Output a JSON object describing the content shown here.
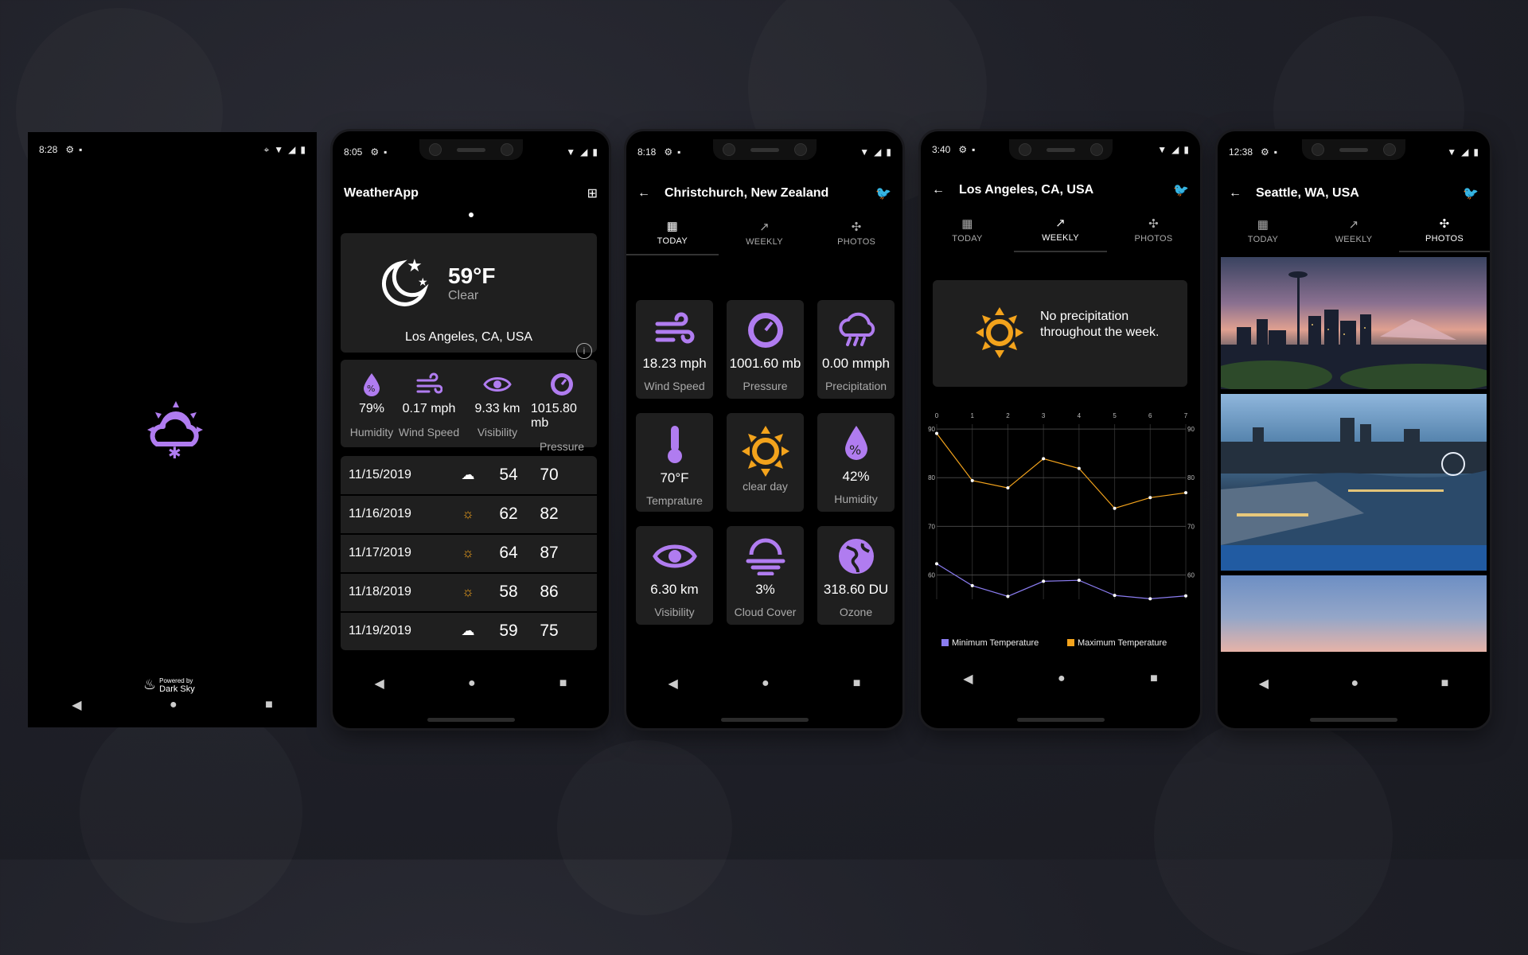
{
  "accent": "#b07cf0",
  "sun_color": "#f3a31c",
  "splash": {
    "time": "8:28",
    "powered_by": "Powered by",
    "dark_sky": "Dark Sky",
    "nav": [
      "◀",
      "●",
      "■"
    ]
  },
  "home": {
    "time": "8:05",
    "app_title": "WeatherApp",
    "current": {
      "temp": "59°F",
      "condition": "Clear",
      "location": "Los Angeles, CA, USA"
    },
    "stats": [
      {
        "value": "79%",
        "label": "Humidity"
      },
      {
        "value": "0.17 mph",
        "label": "Wind Speed"
      },
      {
        "value": "9.33 km",
        "label": "Visibility"
      },
      {
        "value": "1015.80 mb",
        "label": "Pressure"
      }
    ],
    "forecast": [
      {
        "date": "11/15/2019",
        "icon": "partly-cloudy-night-icon",
        "low": "54",
        "high": "70"
      },
      {
        "date": "11/16/2019",
        "icon": "sun-icon",
        "low": "62",
        "high": "82"
      },
      {
        "date": "11/17/2019",
        "icon": "sun-icon",
        "low": "64",
        "high": "87"
      },
      {
        "date": "11/18/2019",
        "icon": "sun-icon",
        "low": "58",
        "high": "86"
      },
      {
        "date": "11/19/2019",
        "icon": "partly-cloudy-night-icon",
        "low": "59",
        "high": "75"
      }
    ]
  },
  "today": {
    "time": "8:18",
    "location": "Christchurch, New Zealand",
    "tabs": [
      "TODAY",
      "WEEKLY",
      "PHOTOS"
    ],
    "tiles": [
      {
        "value": "18.23 mph",
        "label": "Wind Speed",
        "icon": "wind-icon"
      },
      {
        "value": "1001.60 mb",
        "label": "Pressure",
        "icon": "gauge-icon"
      },
      {
        "value": "0.00 mmph",
        "label": "Precipitation",
        "icon": "rain-cloud-icon"
      },
      {
        "value": "70°F",
        "label": "Temprature",
        "icon": "thermometer-icon"
      },
      {
        "value": "",
        "label": "clear day",
        "icon": "sun-icon"
      },
      {
        "value": "42%",
        "label": "Humidity",
        "icon": "droplet-icon"
      },
      {
        "value": "6.30 km",
        "label": "Visibility",
        "icon": "eye-icon"
      },
      {
        "value": "3%",
        "label": "Cloud Cover",
        "icon": "cloud-cover-icon"
      },
      {
        "value": "318.60 DU",
        "label": "Ozone",
        "icon": "globe-icon"
      }
    ]
  },
  "weekly": {
    "time": "3:40",
    "location": "Los Angeles, CA, USA",
    "tabs": [
      "TODAY",
      "WEEKLY",
      "PHOTOS"
    ],
    "precip_text_1": "No precipitation",
    "precip_text_2": "throughout the week."
  },
  "chart_data": {
    "type": "line",
    "x": [
      0,
      1,
      2,
      3,
      4,
      5,
      6,
      7
    ],
    "x_ticks": [
      "0",
      "1",
      "2",
      "3",
      "4",
      "5",
      "6",
      "7"
    ],
    "y_ticks": [
      "90",
      "80",
      "70",
      "60"
    ],
    "ylim": [
      55,
      91
    ],
    "grid": true,
    "legend_position": "bottom",
    "series": [
      {
        "name": "Minimum Temperature",
        "color": "#8a7cf0",
        "values": [
          62.3,
          57.8,
          55.6,
          58.7,
          58.9,
          55.8,
          55.1,
          55.7
        ]
      },
      {
        "name": "Maximum Temperature",
        "color": "#f3a31c",
        "values": [
          89.1,
          79.4,
          77.9,
          83.9,
          81.9,
          73.7,
          75.9,
          76.9
        ]
      }
    ]
  },
  "photos": {
    "time": "12:38",
    "location": "Seattle, WA, USA",
    "tabs": [
      "TODAY",
      "WEEKLY",
      "PHOTOS"
    ]
  }
}
